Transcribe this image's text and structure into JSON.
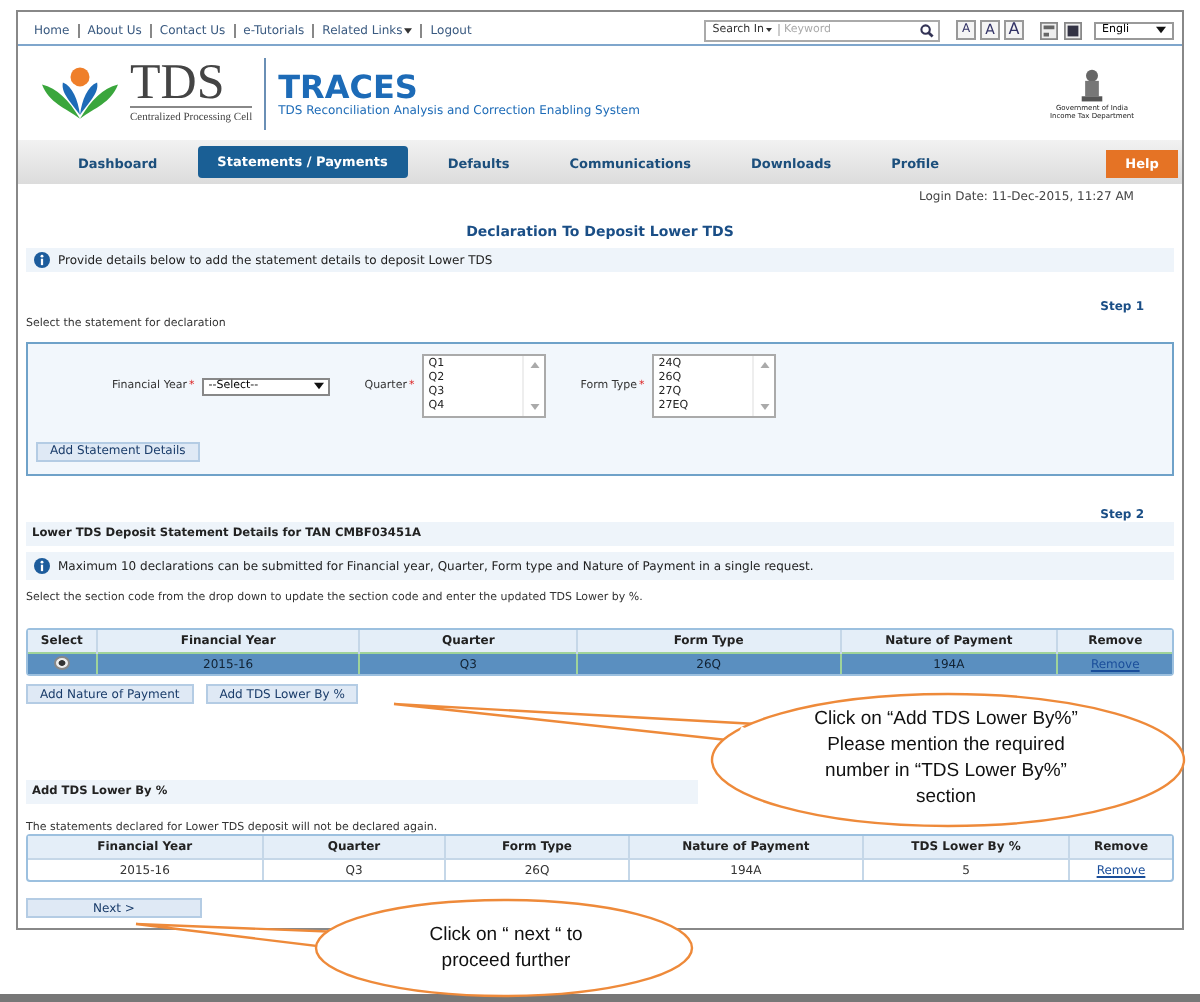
{
  "top_links": [
    {
      "label": "Home",
      "kind": "link"
    },
    {
      "label": "About Us",
      "kind": "link"
    },
    {
      "label": "Contact Us",
      "kind": "link"
    },
    {
      "label": "e-Tutorials",
      "kind": "link"
    },
    {
      "label": "Related Links",
      "kind": "menu"
    },
    {
      "label": "Logout",
      "kind": "link"
    }
  ],
  "search": {
    "scope": "Search In",
    "placeholder": "Keyword"
  },
  "font_size_buttons": [
    "A",
    "A",
    "A"
  ],
  "language": "Engli",
  "logo": {
    "name": "TDS",
    "subtitle": "Centralized Processing Cell"
  },
  "system": {
    "name": "TRACES",
    "full_name": "TDS Reconciliation Analysis and Correction Enabling System"
  },
  "emblem_caption": [
    "Government of India",
    "Income Tax Department"
  ],
  "nav": [
    {
      "label": "Dashboard",
      "selected": false
    },
    {
      "label": "Statements / Payments",
      "selected": true
    },
    {
      "label": "Defaults",
      "selected": false
    },
    {
      "label": "Communications",
      "selected": false
    },
    {
      "label": "Downloads",
      "selected": false
    },
    {
      "label": "Profile",
      "selected": false
    }
  ],
  "help_button": "Help",
  "login_date": "Login Date: 11-Dec-2015, 11:27 AM",
  "page_title": "Declaration To Deposit Lower TDS",
  "info": "Provide details below to add the statement details to deposit Lower TDS",
  "step1": {
    "step": "Step 1",
    "instruction": "Select the statement for  declaration",
    "financial_year": {
      "label": "Financial Year",
      "marker": "*",
      "value": "--Select--"
    },
    "quarter": {
      "label": "Quarter",
      "marker": "*",
      "options": [
        "Q1",
        "Q2",
        "Q3",
        "Q4"
      ]
    },
    "form_type": {
      "label": "Form Type",
      "marker": "*",
      "options": [
        "24Q",
        "26Q",
        "27Q",
        "27EQ"
      ]
    },
    "button": "Add Statement Details"
  },
  "step2": {
    "step": "Step 2",
    "heading": "Lower TDS Deposit Statement Details for TAN CMBF03451A",
    "info": "Maximum 10 declarations can be submitted for Financial year, Quarter, Form type and Nature of Payment in a single request.",
    "instruction": "Select the section code from the drop down to update the section code and enter the updated TDS Lower by %.",
    "table": {
      "select_column": "Select",
      "columns": [
        "Financial Year",
        "Quarter",
        "Form Type",
        "Nature of Payment"
      ],
      "remove_column": "Remove",
      "rows": [
        {
          "selected": true,
          "cells": [
            "2015-16",
            "Q3",
            "26Q",
            "194A"
          ],
          "remove": "Remove"
        }
      ]
    },
    "buttons": [
      "Add Nature of Payment",
      "Add TDS Lower By %"
    ]
  },
  "lower_by": {
    "heading": "Add TDS Lower By %",
    "note": "The statements declared for Lower TDS deposit will not be declared again.",
    "table": {
      "columns": [
        "Financial Year",
        "Quarter",
        "Form Type",
        "Nature of Payment",
        "TDS Lower By %"
      ],
      "remove_column": "Remove",
      "rows": [
        {
          "cells": [
            "2015-16",
            "Q3",
            "26Q",
            "194A",
            "5"
          ],
          "remove": "Remove"
        }
      ]
    }
  },
  "next_button": "Next >",
  "callouts": [
    "Click on “Add TDS Lower By%” Please mention the required number in “TDS Lower By%” section",
    "Click on “ next “ to proceed further"
  ]
}
